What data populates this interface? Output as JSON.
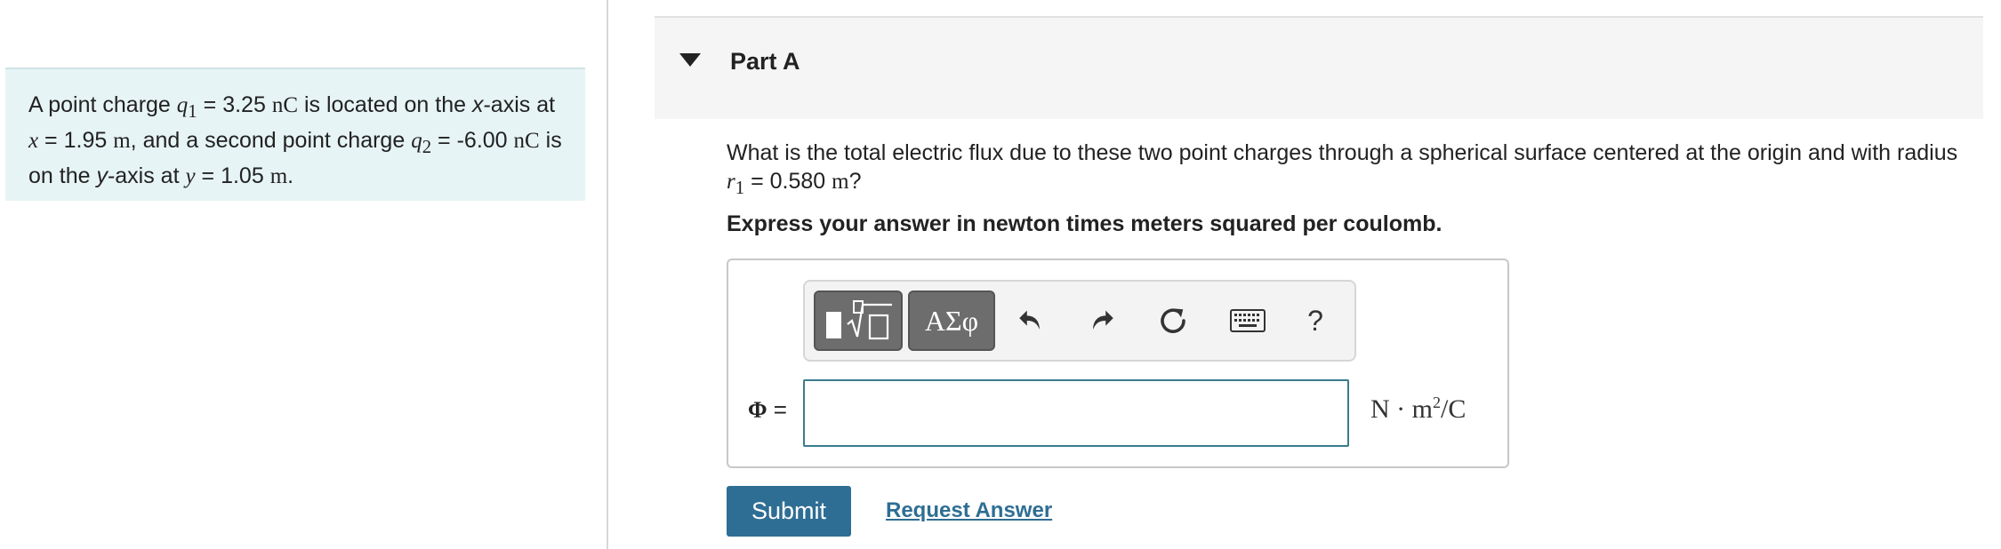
{
  "problem": {
    "p1": "A point charge ",
    "q1": "q",
    "q1_sub": "1",
    "eq1": " = 3.25 ",
    "unit_nC": "nC",
    "p2": " is located on the ",
    "xaxis": "x",
    "p3": "-axis at ",
    "x": "x",
    "eq2": " = 1.95 ",
    "unit_m": "m",
    "p4": ", and a second point charge ",
    "q2": "q",
    "q2_sub": "2",
    "eq3": " = -6.00 ",
    "p5": " is on the ",
    "yaxis": "y",
    "p6": "-axis at ",
    "y": "y",
    "eq4": " = 1.05 ",
    "p7": "."
  },
  "part": {
    "title": "Part A"
  },
  "question": {
    "p1": "What is the total electric flux due to these two point charges through a spherical surface centered at the origin and with radius ",
    "r": "r",
    "r_sub": "1",
    "eq": " = 0.580 ",
    "unit": "m",
    "p2": "?"
  },
  "instruction": "Express your answer in newton times meters squared per coulomb.",
  "toolbar": {
    "symbols_label": "ΑΣφ",
    "help_label": "?",
    "icons": [
      "templates-icon",
      "undo-icon",
      "redo-icon",
      "reset-icon",
      "keyboard-icon"
    ]
  },
  "answer": {
    "variable": "Φ",
    "equals": " =",
    "value": "",
    "unit_pre": "N · m",
    "unit_exp": "2",
    "unit_post": "/C"
  },
  "buttons": {
    "submit": "Submit",
    "request_answer": "Request Answer"
  },
  "colors": {
    "problem_bg": "#e7f4f5",
    "accent": "#2e6e94",
    "toolbar_button": "#6d6d6d"
  }
}
